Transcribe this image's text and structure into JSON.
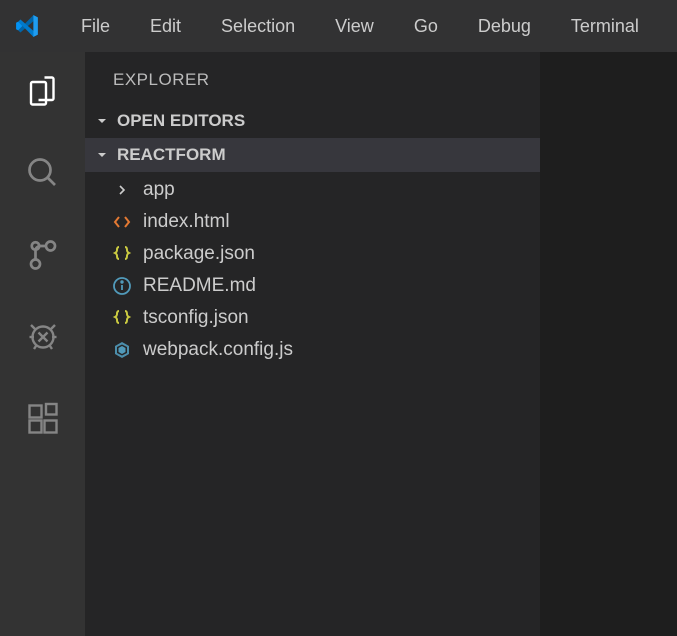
{
  "menu": [
    "File",
    "Edit",
    "Selection",
    "View",
    "Go",
    "Debug",
    "Terminal"
  ],
  "sidebar": {
    "title": "EXPLORER",
    "openEditors": "OPEN EDITORS",
    "projectName": "REACTFORM"
  },
  "tree": {
    "folder": "app",
    "files": [
      {
        "name": "index.html",
        "icon": "html"
      },
      {
        "name": "package.json",
        "icon": "json"
      },
      {
        "name": "README.md",
        "icon": "info"
      },
      {
        "name": "tsconfig.json",
        "icon": "json"
      },
      {
        "name": "webpack.config.js",
        "icon": "webpack"
      }
    ]
  },
  "colors": {
    "html": "#e37933",
    "json": "#cbcb41",
    "info": "#519aba",
    "webpack": "#519aba"
  }
}
